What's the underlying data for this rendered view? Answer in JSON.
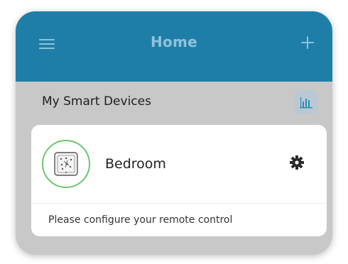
{
  "header": {
    "title": "Home",
    "menu_icon": "hamburger-menu-icon",
    "add_icon": "plus-icon"
  },
  "section": {
    "title": "My Smart Devices",
    "chart_icon": "bar-chart-icon"
  },
  "devices": [
    {
      "name": "Bedroom",
      "thumbnail_icon": "remote-control-icon",
      "settings_icon": "gear-icon",
      "status_message": "Please configure your remote control"
    }
  ],
  "colors": {
    "header_bg": "#1f7ea8",
    "header_fg": "#8fc3dc",
    "body_bg": "#c8c8c8",
    "card_bg": "#ffffff",
    "thumbnail_ring": "#6cc76a"
  }
}
